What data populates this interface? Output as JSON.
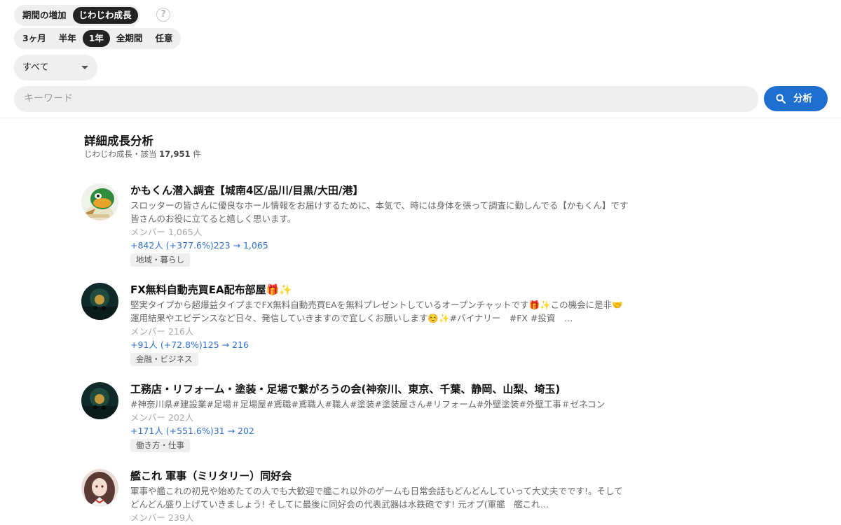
{
  "filters": {
    "mode_tabs": [
      "期間の増加",
      "じわじわ成長"
    ],
    "mode_active": 1,
    "help_symbol": "?",
    "period_tabs": [
      "3ヶ月",
      "半年",
      "1年",
      "全期間",
      "任意"
    ],
    "period_active": 2,
    "category_value": "すべて"
  },
  "search": {
    "placeholder": "キーワード",
    "button_label": "分析"
  },
  "results": {
    "title": "詳細成長分析",
    "subtitle_prefix": "じわじわ成長・該当 ",
    "count": "17,951",
    "subtitle_suffix": " 件"
  },
  "items": [
    {
      "title": "かもくん潜入調査【城南4区/品川/目黒/大田/港】",
      "description": "スロッターの皆さんに優良なホール情報をお届けするために、本気で、時には身体を張って調査に勤しんでる【かもくん】です 皆さんのお役に立てると嬉しく思います。",
      "members": "メンバー 1,065人",
      "growth": "+842人 (+377.6%)223 → 1,065",
      "tag": "地域・暮らし",
      "avatar": "duck-avatar"
    },
    {
      "title": "FX無料自動売買EA配布部屋🎁✨",
      "description": "堅実タイプから超爆益タイプまでFX無料自動売買EAを無料プレゼントしているオープンチャットです🎁✨この機会に是非🤝運用結果やエビデンスなど日々、発信していきますので宜しくお願いします☺️✨#バイナリー　#FX #投資　…",
      "members": "メンバー 216人",
      "growth": "+91人 (+72.8%)125 → 216",
      "tag": "金融・ビジネス",
      "avatar": "night-scene-avatar"
    },
    {
      "title": "工務店・リフォーム・塗装・足場で繋がろうの会(神奈川、東京、千葉、静岡、山梨、埼玉)",
      "description": "#神奈川県#建設業#足場＃足場屋#鳶職#鳶職人#職人#塗装#塗装屋さん#リフォーム#外壁塗装#外壁工事＃ゼネコン",
      "members": "メンバー 202人",
      "growth": "+171人 (+551.6%)31 → 202",
      "tag": "働き方・仕事",
      "avatar": "night-scene-avatar"
    },
    {
      "title": "艦これ 軍事（ミリタリー）同好会",
      "description": "軍事や艦これの初見や始めたての人でも大歓迎で艦これ以外のゲームも日常会話もどんどんしていって大丈夫でです!。そしてどんどん盛り上げていきましょう! そしてに最後に同好会の代表武器は水鉄砲です! 元オプ(軍艦　艦これ…",
      "members": "メンバー 239人",
      "growth": "",
      "tag": "",
      "avatar": "anime-girl-avatar"
    }
  ]
}
